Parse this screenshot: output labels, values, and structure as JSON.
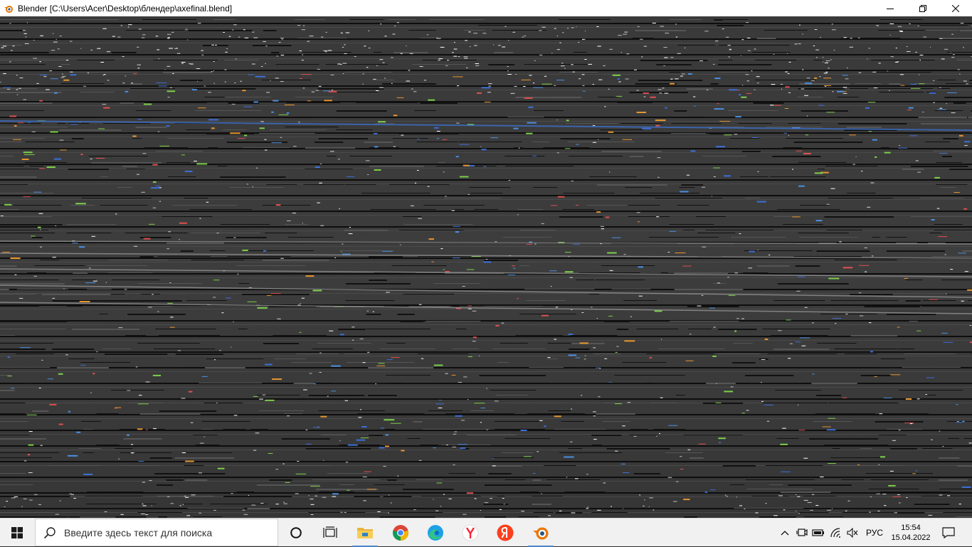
{
  "window": {
    "title": "Blender [C:\\Users\\Acer\\Desktop\\блендер\\axefinal.blend]",
    "icon": "blender-icon",
    "controls": [
      "minimize-icon",
      "maximize-icon",
      "close-icon"
    ]
  },
  "viewport": {
    "state": "corrupted"
  },
  "taskbar": {
    "search": {
      "placeholder": "Введите здесь текст для поиска"
    },
    "pinned": [
      {
        "name": "cortana",
        "icon": "cortana-circle-icon",
        "active": false
      },
      {
        "name": "task-view",
        "icon": "task-view-icon",
        "active": false
      },
      {
        "name": "file-explorer",
        "icon": "folder-icon",
        "active": true
      },
      {
        "name": "chrome",
        "icon": "chrome-icon",
        "active": false
      },
      {
        "name": "edge",
        "icon": "edge-icon",
        "active": false
      },
      {
        "name": "yandex-browser",
        "icon": "yandex-browser-icon",
        "active": false
      },
      {
        "name": "yandex",
        "icon": "yandex-icon",
        "active": false
      },
      {
        "name": "blender",
        "icon": "blender-icon",
        "active": true
      }
    ],
    "tray": {
      "language": "РУС",
      "time": "15:54",
      "date": "15.04.2022"
    }
  },
  "colors": {
    "accent": "#4a88c7",
    "viewport_bg": "#3a3a3a",
    "taskbar_bg": "#f1f1f1"
  }
}
